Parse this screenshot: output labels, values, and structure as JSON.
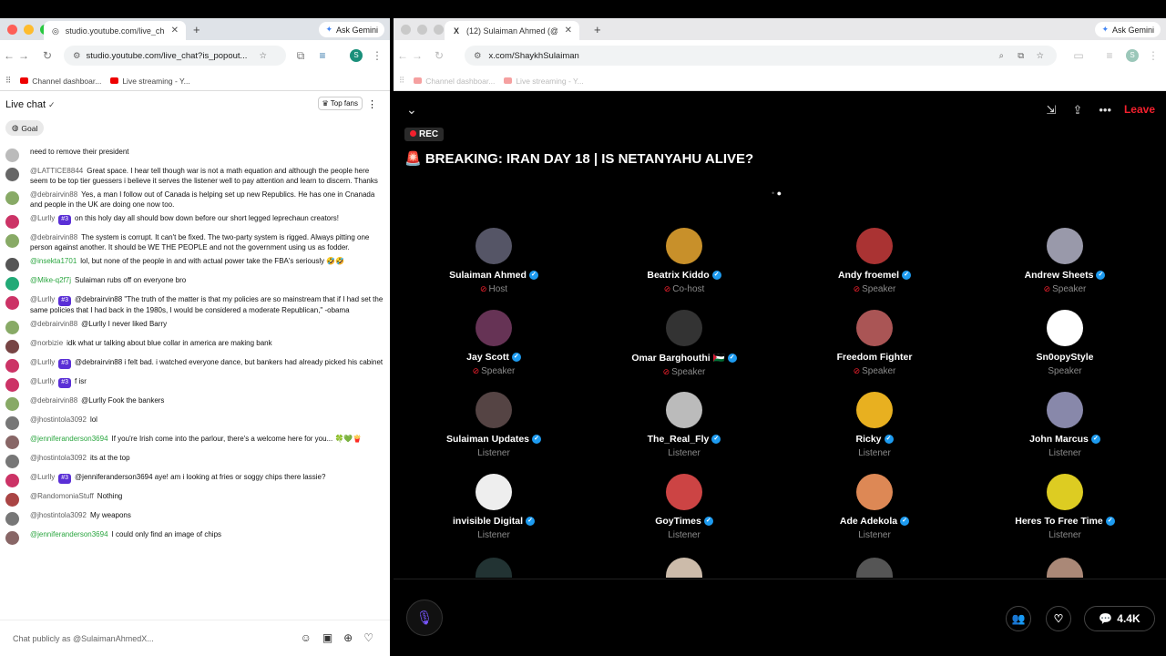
{
  "left_window": {
    "tab_title": "studio.youtube.com/live_chat",
    "url": "studio.youtube.com/live_chat?is_popout...",
    "gemini": "Ask Gemini",
    "bookmarks": [
      "Channel dashboar...",
      "Live streaming - Y..."
    ],
    "chat_title": "Live chat",
    "top_fans": "Top fans",
    "goal": "Goal",
    "input_placeholder": "Chat publicly as @SulaimanAhmedX...",
    "messages": [
      {
        "author": "",
        "badge": "",
        "text": "need to remove their president",
        "color": "#bbb",
        "green": false
      },
      {
        "author": "@LATTICE8844",
        "badge": "",
        "text": "Great space. I hear tell though war is not a math equation and although the people here seem to be top tier guessers i believe it serves the listener well to pay attention and learn to discern. Thanks",
        "color": "#666",
        "green": false
      },
      {
        "author": "@debrairvin88",
        "badge": "",
        "text": "Yes, a man I follow out of Canada is helping set up new Republics. He has one in Cnanada and people in the UK are doing one now too.",
        "color": "#8a6",
        "green": false
      },
      {
        "author": "@Lurlly",
        "badge": "#3",
        "text": "on this holy day all should bow down before our short legged leprechaun creators!",
        "color": "#c36",
        "green": false
      },
      {
        "author": "@debrairvin88",
        "badge": "",
        "text": "The system is corrupt. It can't be fixed. The two-party system is rigged. Always pitting one person against another. It should be WE THE PEOPLE and not the government using us as fodder.",
        "color": "#8a6",
        "green": false
      },
      {
        "author": "@insekta1701",
        "badge": "",
        "text": "lol, but none of the people in and with actual power take the FBA's seriously 🤣🤣",
        "color": "#555",
        "green": true
      },
      {
        "author": "@Mike-q2f7j",
        "badge": "",
        "text": "Sulaiman rubs off on everyone bro",
        "color": "#2a7",
        "green": true
      },
      {
        "author": "@Lurlly",
        "badge": "#3",
        "text": "@debrairvin88 \"The truth of the matter is that my policies are so mainstream that if I had set the same policies that I had back in the 1980s, I would be considered a moderate Republican,\" -obama",
        "color": "#c36",
        "green": false
      },
      {
        "author": "@debrairvin88",
        "badge": "",
        "text": "@Lurlly I never liked Barry",
        "color": "#8a6",
        "green": false
      },
      {
        "author": "@norbizie",
        "badge": "",
        "text": "idk what ur talking about blue collar in america are making bank",
        "color": "#744",
        "green": false
      },
      {
        "author": "@Lurlly",
        "badge": "#3",
        "text": "@debrairvin88 i felt bad. i watched everyone dance, but bankers had already picked his cabinet",
        "color": "#c36",
        "green": false
      },
      {
        "author": "@Lurlly",
        "badge": "#3",
        "text": "f isr",
        "color": "#c36",
        "green": false
      },
      {
        "author": "@debrairvin88",
        "badge": "",
        "text": "@Lurlly Fook the bankers",
        "color": "#8a6",
        "green": false
      },
      {
        "author": "@jhostintola3092",
        "badge": "",
        "text": "lol",
        "color": "#777",
        "green": false
      },
      {
        "author": "@jenniferanderson3694",
        "badge": "",
        "text": "If you're Irish come into the parlour, there's a welcome here for you... 🍀💚🍟",
        "color": "#866",
        "green": true
      },
      {
        "author": "@jhostintola3092",
        "badge": "",
        "text": "its at the top",
        "color": "#777",
        "green": false
      },
      {
        "author": "@Lurlly",
        "badge": "#3",
        "text": "@jenniferanderson3694 aye! am i looking at fries or soggy chips there lassie?",
        "color": "#c36",
        "green": false
      },
      {
        "author": "@RandomoniaStuff",
        "badge": "",
        "text": "Nothing",
        "color": "#a44",
        "green": false
      },
      {
        "author": "@jhostintola3092",
        "badge": "",
        "text": "My weapons",
        "color": "#777",
        "green": false
      },
      {
        "author": "@jenniferanderson3694",
        "badge": "",
        "text": "I could only find an image of chips",
        "color": "#866",
        "green": true
      }
    ]
  },
  "right_window": {
    "tab_title": "(12) Sulaiman Ahmed (@S",
    "url": "x.com/ShaykhSulaiman",
    "gemini": "Ask Gemini",
    "bookmarks": [
      "Channel dashboar...",
      "Live streaming - Y..."
    ],
    "rec": "REC",
    "title": "🚨 BREAKING: IRAN DAY 18 | IS NETANYAHU ALIVE?",
    "leave": "Leave",
    "count": "4.4K",
    "speakers": [
      {
        "name": "Sulaiman Ahmed",
        "role": "Host",
        "muted": true,
        "verified": true,
        "color": "#556"
      },
      {
        "name": "Beatrix Kiddo",
        "role": "Co-host",
        "muted": true,
        "verified": true,
        "color": "#c8902a"
      },
      {
        "name": "Andy froemel",
        "role": "Speaker",
        "muted": true,
        "verified": true,
        "color": "#a33"
      },
      {
        "name": "Andrew Sheets",
        "role": "Speaker",
        "muted": true,
        "verified": true,
        "color": "#99a"
      },
      {
        "name": "Jay Scott",
        "role": "Speaker",
        "muted": true,
        "verified": true,
        "color": "#635"
      },
      {
        "name": "Omar Barghouthi 🇵🇸",
        "role": "Speaker",
        "muted": true,
        "verified": true,
        "color": "#333"
      },
      {
        "name": "Freedom Fighter",
        "role": "Speaker",
        "muted": true,
        "verified": false,
        "color": "#a55"
      },
      {
        "name": "Sn0opyStyle",
        "role": "Speaker",
        "muted": false,
        "verified": false,
        "color": "#fff"
      },
      {
        "name": "Sulaiman Updates",
        "role": "Listener",
        "muted": false,
        "verified": true,
        "color": "#544"
      },
      {
        "name": "The_Real_Fly",
        "role": "Listener",
        "muted": false,
        "verified": true,
        "color": "#bbb"
      },
      {
        "name": "Ricky",
        "role": "Listener",
        "muted": false,
        "verified": true,
        "color": "#e8b020"
      },
      {
        "name": "John Marcus",
        "role": "Listener",
        "muted": false,
        "verified": true,
        "color": "#88a"
      },
      {
        "name": "invisible Digital",
        "role": "Listener",
        "muted": false,
        "verified": true,
        "color": "#eee"
      },
      {
        "name": "GoyTimes",
        "role": "Listener",
        "muted": false,
        "verified": true,
        "color": "#c44"
      },
      {
        "name": "Ade Adekola",
        "role": "Listener",
        "muted": false,
        "verified": true,
        "color": "#d85"
      },
      {
        "name": "Heres To Free Time",
        "role": "Listener",
        "muted": false,
        "verified": true,
        "color": "#dc2"
      }
    ]
  }
}
